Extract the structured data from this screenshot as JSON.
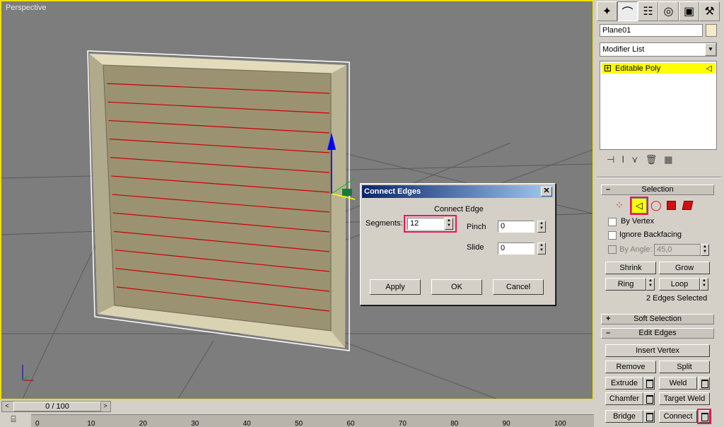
{
  "viewport": {
    "label": "Perspective"
  },
  "timeline": {
    "position": "0 / 100",
    "ticks": [
      "0",
      "10",
      "20",
      "30",
      "40",
      "50",
      "60",
      "70",
      "80",
      "90",
      "100"
    ]
  },
  "panel": {
    "tabs": [
      {
        "name": "create",
        "icon": "cursor-star-icon"
      },
      {
        "name": "modify",
        "icon": "bend-arc-icon"
      },
      {
        "name": "hierarchy",
        "icon": "hierarchy-icon"
      },
      {
        "name": "motion",
        "icon": "motion-wheel-icon"
      },
      {
        "name": "display",
        "icon": "display-monitor-icon"
      },
      {
        "name": "utilities",
        "icon": "hammer-icon"
      }
    ],
    "object_name": "Plane01",
    "modifier_list": "Modifier List",
    "stack_item": "Editable Poly",
    "selection": {
      "title": "Selection",
      "by_vertex": "By Vertex",
      "ignore_backfacing": "Ignore Backfacing",
      "by_angle": "By Angle:",
      "angle_value": "45,0",
      "shrink": "Shrink",
      "grow": "Grow",
      "ring": "Ring",
      "loop": "Loop",
      "status": "2 Edges Selected"
    },
    "soft_selection": "Soft Selection",
    "edit_edges": {
      "title": "Edit Edges",
      "insert_vertex": "Insert Vertex",
      "remove": "Remove",
      "split": "Split",
      "extrude": "Extrude",
      "weld": "Weld",
      "chamfer": "Chamfer",
      "target_weld": "Target Weld",
      "bridge": "Bridge",
      "connect": "Connect"
    }
  },
  "dialog": {
    "title": "Connect Edges",
    "group": "Connect Edge",
    "segments_label": "Segments:",
    "segments_value": "12",
    "pinch_label": "Pinch",
    "pinch_value": "0",
    "slide_label": "Slide",
    "slide_value": "0",
    "apply": "Apply",
    "ok": "OK",
    "cancel": "Cancel"
  },
  "colors": {
    "viewport_border": "#f0e000",
    "highlight": "#e8185c",
    "selected_edge": "#cc0000",
    "mesh": "#9b9272"
  }
}
